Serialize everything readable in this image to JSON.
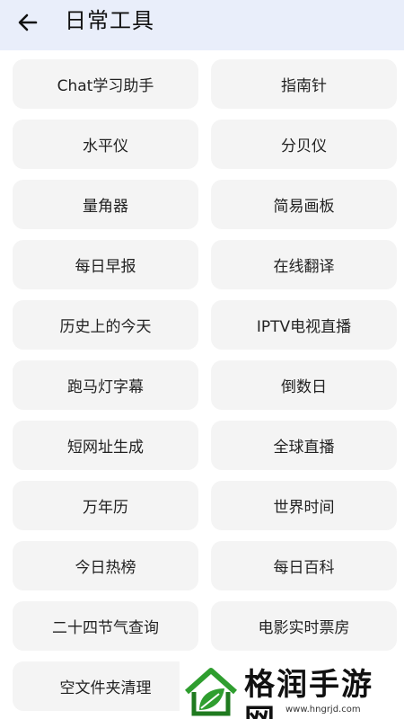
{
  "header": {
    "title": "日常工具",
    "back_icon": "arrow-left-icon"
  },
  "tools": [
    "Chat学习助手",
    "指南针",
    "水平仪",
    "分贝仪",
    "量角器",
    "简易画板",
    "每日早报",
    "在线翻译",
    "历史上的今天",
    "IPTV电视直播",
    "跑马灯字幕",
    "倒数日",
    "短网址生成",
    "全球直播",
    "万年历",
    "世界时间",
    "今日热榜",
    "每日百科",
    "二十四节气查询",
    "电影实时票房",
    "空文件夹清理",
    ""
  ],
  "watermark": {
    "text": "格润手游网",
    "url": "www.hngrjd.com",
    "logo_icon": "leaf-house-logo-icon",
    "colors": {
      "green": "#2f9e2f",
      "dark_green": "#1f7a1f"
    }
  },
  "colors": {
    "header_bg": "#e9eefa",
    "tile_bg": "#f4f4f4",
    "text": "#222222"
  }
}
